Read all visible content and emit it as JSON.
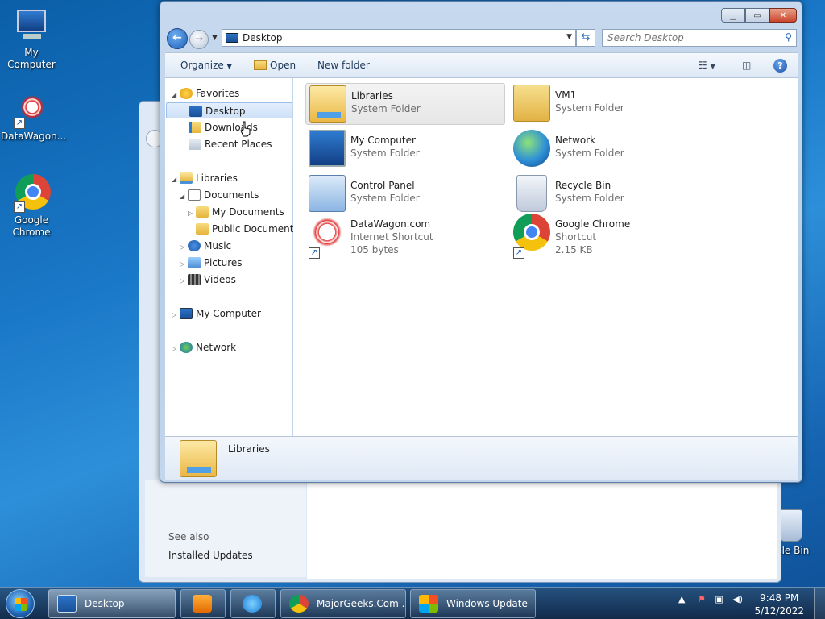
{
  "desktop": {
    "icons": [
      {
        "label": "My Computer"
      },
      {
        "label": "DataWagon..."
      },
      {
        "label": "Google Chrome"
      },
      {
        "label": "cle Bin"
      }
    ]
  },
  "back_window": {
    "see_also": "See also",
    "installed_updates": "Installed Updates"
  },
  "explorer": {
    "address": "Desktop",
    "search_placeholder": "Search Desktop",
    "toolbar": {
      "organize": "Organize",
      "open": "Open",
      "new_folder": "New folder"
    },
    "nav": {
      "favorites": "Favorites",
      "desktop": "Desktop",
      "downloads": "Downloads",
      "recent_places": "Recent Places",
      "libraries": "Libraries",
      "documents": "Documents",
      "my_documents": "My Documents",
      "public_documents": "Public Documents",
      "music": "Music",
      "pictures": "Pictures",
      "videos": "Videos",
      "my_computer": "My Computer",
      "network": "Network"
    },
    "items": [
      {
        "name": "Libraries",
        "type": "System Folder",
        "extra": ""
      },
      {
        "name": "VM1",
        "type": "System Folder",
        "extra": ""
      },
      {
        "name": "My Computer",
        "type": "System Folder",
        "extra": ""
      },
      {
        "name": "Network",
        "type": "System Folder",
        "extra": ""
      },
      {
        "name": "Control Panel",
        "type": "System Folder",
        "extra": ""
      },
      {
        "name": "Recycle Bin",
        "type": "System Folder",
        "extra": ""
      },
      {
        "name": "DataWagon.com",
        "type": "Internet Shortcut",
        "extra": "105 bytes"
      },
      {
        "name": "Google Chrome",
        "type": "Shortcut",
        "extra": "2.15 KB"
      }
    ],
    "details": {
      "label": "Libraries"
    }
  },
  "taskbar": {
    "buttons": [
      {
        "label": "Desktop"
      },
      {
        "label": ""
      },
      {
        "label": ""
      },
      {
        "label": "MajorGeeks.Com ..."
      },
      {
        "label": "Windows Update"
      }
    ],
    "clock": {
      "time": "9:48 PM",
      "date": "5/12/2022"
    }
  }
}
